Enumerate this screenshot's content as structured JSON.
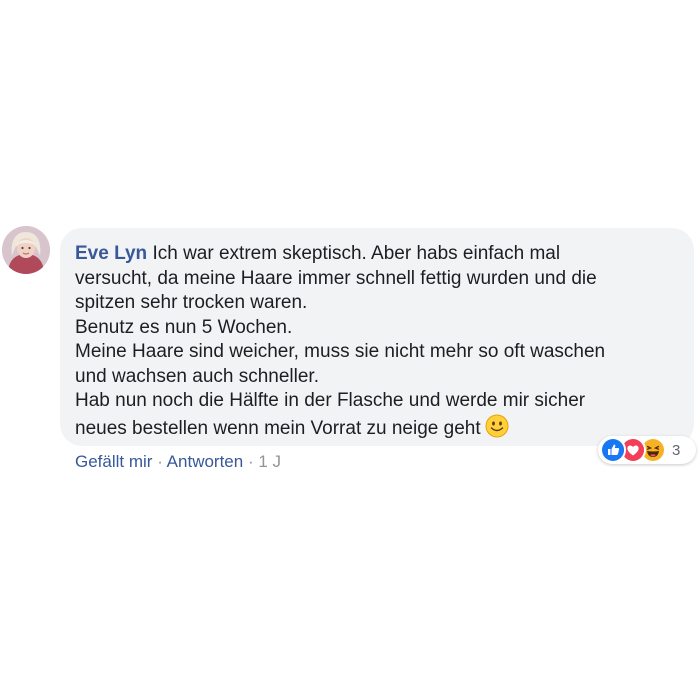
{
  "comment": {
    "author": "Eve Lyn",
    "lines": [
      "Ich war extrem skeptisch. Aber habs einfach mal",
      "versucht, da meine Haare immer schnell fettig wurden und die",
      "spitzen sehr trocken waren.",
      "Benutz es nun 5 Wochen.",
      "Meine Haare sind weicher, muss sie nicht mehr so oft waschen",
      "und wachsen auch schneller.",
      "Hab nun noch die Hälfte in der Flasche und werde mir sicher",
      "neues bestellen wenn mein Vorrat zu neige geht"
    ],
    "emoji": "slightly-smiling-face-icon"
  },
  "reactions": {
    "icons": [
      "like-icon",
      "love-icon",
      "haha-icon"
    ],
    "count": "3"
  },
  "actions": {
    "like_label": "Gefällt mir",
    "separator": "·",
    "reply_label": "Antworten",
    "time": "1 J"
  },
  "colors": {
    "bubble": "#f2f3f5",
    "author": "#385898",
    "text": "#1c1e21",
    "meta": "#90949c",
    "like": "#1877f2",
    "love": "#f33e58",
    "haha": "#f7b125"
  }
}
